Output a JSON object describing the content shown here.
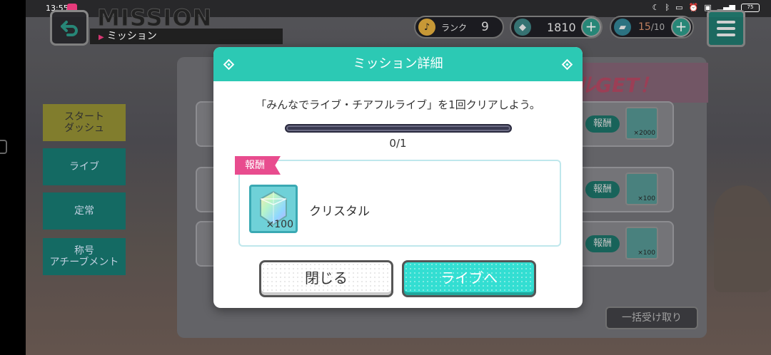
{
  "status": {
    "time": "13:55",
    "battery": "75"
  },
  "header": {
    "title": "MISSION",
    "subtitle": "ミッション"
  },
  "currency": {
    "rank_label": "ランク",
    "rank_value": "9",
    "crystals": "1810",
    "stamina_current": "15",
    "stamina_max": "/10"
  },
  "banner": {
    "text": "ルGET！"
  },
  "sidebar": {
    "items": [
      {
        "label": "スタート\nダッシュ"
      },
      {
        "label": "ライブ"
      },
      {
        "label": "定常"
      },
      {
        "label": "称号\nアチーブメント"
      }
    ]
  },
  "background_rows": [
    {
      "reward_label": "報酬",
      "qty": "×2000"
    },
    {
      "reward_label": "報酬",
      "qty": "×100"
    },
    {
      "reward_label": "報酬",
      "qty": "×100"
    }
  ],
  "bulk_button": "一括受け取り",
  "modal": {
    "title": "ミッション詳細",
    "description": "「みんなでライブ・チアフルライブ」を1回クリアしよう。",
    "progress_current": 0,
    "progress_total": 1,
    "progress_text": "0/1",
    "reward_label": "報酬",
    "reward_item": {
      "name": "クリスタル",
      "qty": "×100",
      "icon": "crystal-icon"
    },
    "close_button": "閉じる",
    "live_button": "ライブへ"
  },
  "colors": {
    "accent": "#2cc9b4",
    "reward_pink": "#e84c8e",
    "live_button": "#33ded2"
  }
}
